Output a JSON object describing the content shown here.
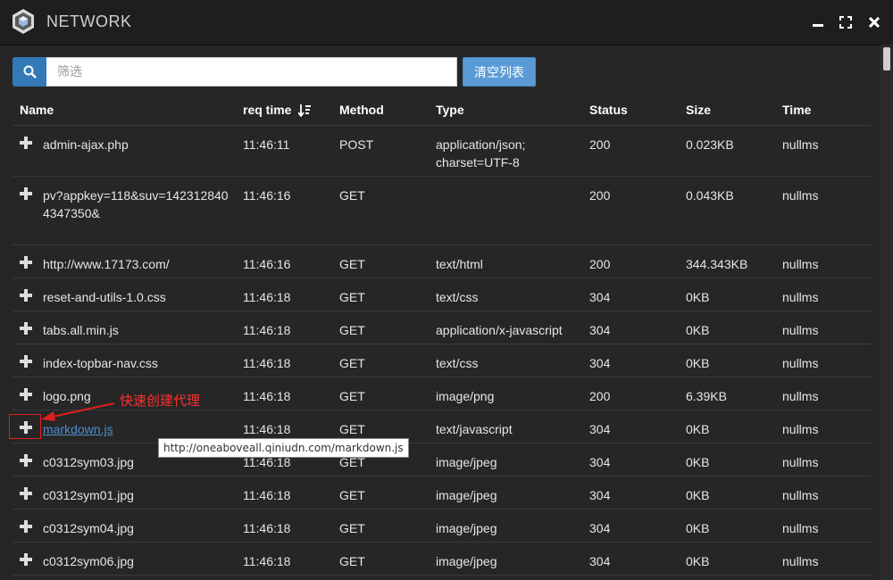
{
  "window": {
    "title": "NETWORK"
  },
  "search": {
    "placeholder": "筛选",
    "value": ""
  },
  "toolbar": {
    "clear_label": "清空列表"
  },
  "columns": {
    "name": "Name",
    "req_time": "req time",
    "method": "Method",
    "type": "Type",
    "status": "Status",
    "size": "Size",
    "time": "Time"
  },
  "rows": [
    {
      "name": "admin-ajax.php",
      "time": "11:46:11",
      "method": "POST",
      "type": "application/json; charset=UTF-8",
      "status": "200",
      "size": "0.023KB",
      "duration": "nullms"
    },
    {
      "name": "pv?appkey=118&suv=1423128404347350&",
      "time": "11:46:16",
      "method": "GET",
      "type": "",
      "status": "200",
      "size": "0.043KB",
      "duration": "nullms"
    },
    {
      "name": "http://www.17173.com/",
      "time": "11:46:16",
      "method": "GET",
      "type": "text/html",
      "status": "200",
      "size": "344.343KB",
      "duration": "nullms"
    },
    {
      "name": "reset-and-utils-1.0.css",
      "time": "11:46:18",
      "method": "GET",
      "type": "text/css",
      "status": "304",
      "size": "0KB",
      "duration": "nullms"
    },
    {
      "name": "tabs.all.min.js",
      "time": "11:46:18",
      "method": "GET",
      "type": "application/x-javascript",
      "status": "304",
      "size": "0KB",
      "duration": "nullms"
    },
    {
      "name": "index-topbar-nav.css",
      "time": "11:46:18",
      "method": "GET",
      "type": "text/css",
      "status": "304",
      "size": "0KB",
      "duration": "nullms"
    },
    {
      "name": "logo.png",
      "time": "11:46:18",
      "method": "GET",
      "type": "image/png",
      "status": "200",
      "size": "6.39KB",
      "duration": "nullms"
    },
    {
      "name": "markdown.js",
      "time": "11:46:18",
      "method": "GET",
      "type": "text/javascript",
      "status": "304",
      "size": "0KB",
      "duration": "nullms"
    },
    {
      "name": "c0312sym03.jpg",
      "time": "11:46:18",
      "method": "GET",
      "type": "image/jpeg",
      "status": "304",
      "size": "0KB",
      "duration": "nullms"
    },
    {
      "name": "c0312sym01.jpg",
      "time": "11:46:18",
      "method": "GET",
      "type": "image/jpeg",
      "status": "304",
      "size": "0KB",
      "duration": "nullms"
    },
    {
      "name": "c0312sym04.jpg",
      "time": "11:46:18",
      "method": "GET",
      "type": "image/jpeg",
      "status": "304",
      "size": "0KB",
      "duration": "nullms"
    },
    {
      "name": "c0312sym06.jpg",
      "time": "11:46:18",
      "method": "GET",
      "type": "image/jpeg",
      "status": "304",
      "size": "0KB",
      "duration": "nullms"
    }
  ],
  "annotation": {
    "text": "快速创建代理"
  },
  "tooltip": {
    "text": "http://oneaboveall.qiniudn.com/markdown.js"
  },
  "colors": {
    "accent": "#337ab7",
    "link": "#4f8fd0",
    "annotation": "#e02020"
  }
}
